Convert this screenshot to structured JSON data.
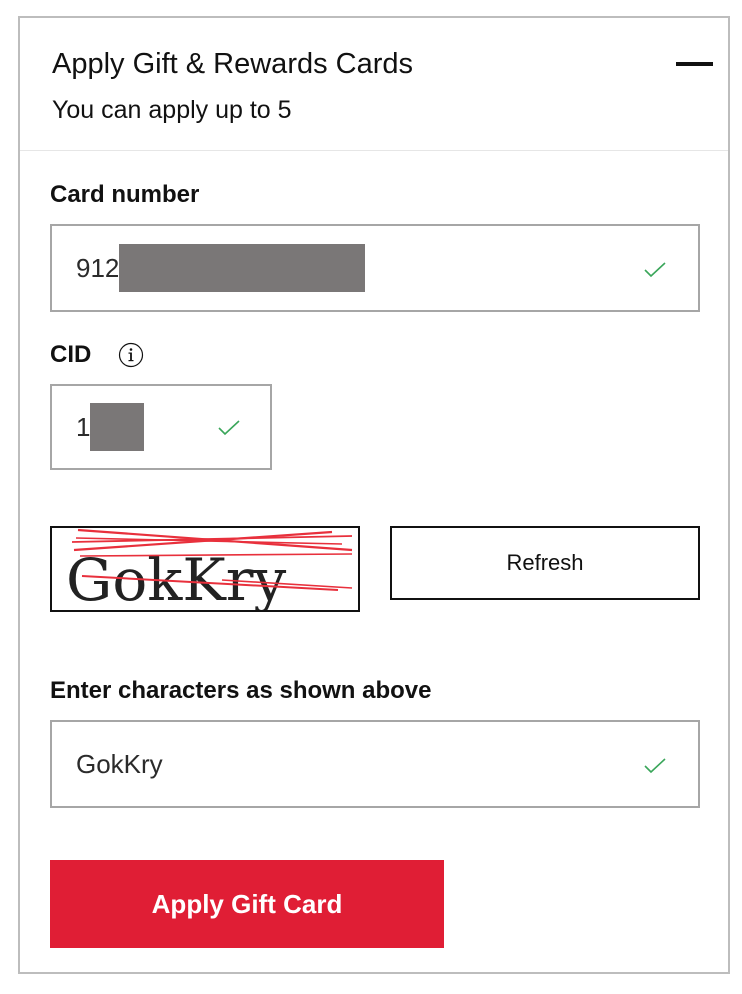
{
  "header": {
    "title": "Apply Gift & Rewards Cards",
    "subtitle": "You can apply up to 5",
    "collapse_icon": "minus-icon"
  },
  "card_number": {
    "label": "Card number",
    "value_visible": "912",
    "masked": true,
    "valid": true,
    "valid_icon": "check-icon"
  },
  "cid": {
    "label": "CID",
    "info_icon": "info-icon",
    "value_visible": "1",
    "masked": true,
    "valid": true,
    "valid_icon": "check-icon"
  },
  "captcha": {
    "image_text": "GokKry",
    "refresh_label": "Refresh"
  },
  "captcha_entry": {
    "label": "Enter characters as shown above",
    "value": "GokKry",
    "valid": true,
    "valid_icon": "check-icon"
  },
  "apply_button": {
    "label": "Apply Gift Card"
  },
  "colors": {
    "accent": "#e01e35",
    "check": "#3aa65a",
    "border": "#a6a6a6",
    "mask": "#7a7777",
    "captcha_lines": "#e8303c"
  }
}
